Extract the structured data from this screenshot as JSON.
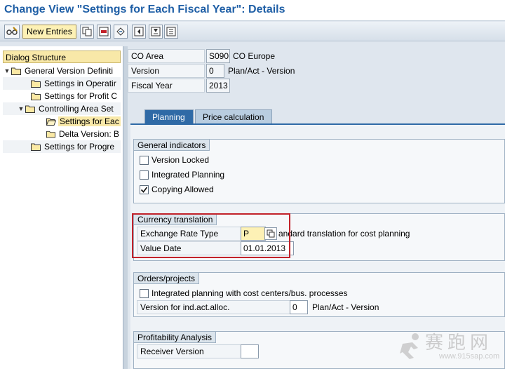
{
  "window": {
    "title": "Change View \"Settings for Each Fiscal Year\": Details"
  },
  "toolbar": {
    "new_entries_label": "New Entries",
    "icons": [
      "glasses-edit-icon",
      "copy-icon",
      "delete-icon",
      "undo-icon",
      "first-page-icon",
      "previous-page-icon",
      "next-page-icon"
    ]
  },
  "dialog_structure": {
    "header": "Dialog Structure",
    "items": [
      {
        "label": "General Version Definiti",
        "level": 0,
        "expanded": true
      },
      {
        "label": "Settings in Operatir",
        "level": 1
      },
      {
        "label": "Settings for Profit C",
        "level": 1
      },
      {
        "label": "Controlling Area Set",
        "level": 1,
        "expanded": true
      },
      {
        "label": "Settings for Eac",
        "level": 2,
        "selected": true
      },
      {
        "label": "Delta Version: B",
        "level": 2
      },
      {
        "label": "Settings for Progre",
        "level": 1
      }
    ]
  },
  "header_fields": {
    "co_area": {
      "label": "CO Area",
      "value": "S090",
      "desc": "CO Europe"
    },
    "version": {
      "label": "Version",
      "value": "0",
      "desc": "Plan/Act - Version"
    },
    "fiscal_year": {
      "label": "Fiscal Year",
      "value": "2013"
    }
  },
  "tabs": [
    {
      "label": "Planning",
      "active": true
    },
    {
      "label": "Price calculation",
      "active": false
    }
  ],
  "general_indicators": {
    "title": "General indicators",
    "version_locked": {
      "label": "Version Locked",
      "checked": false
    },
    "integrated_planning": {
      "label": "Integrated Planning",
      "checked": false
    },
    "copying_allowed": {
      "label": "Copying Allowed",
      "checked": true
    }
  },
  "currency_translation": {
    "title": "Currency translation",
    "exchange_rate_type": {
      "label": "Exchange Rate Type",
      "value": "P",
      "desc": "andard translation for cost planning"
    },
    "value_date": {
      "label": "Value Date",
      "value": "01.01.2013"
    }
  },
  "orders_projects": {
    "title": "Orders/projects",
    "integrated_planning": {
      "label": "Integrated planning with cost centers/bus. processes",
      "checked": false
    },
    "version_alloc": {
      "label": "Version for ind.act.alloc.",
      "value": "0",
      "desc": "Plan/Act - Version"
    }
  },
  "profitability_analysis": {
    "title": "Profitability Analysis",
    "receiver_version": {
      "label": "Receiver Version",
      "value": ""
    }
  },
  "watermark": {
    "text": "赛跑网",
    "url": "www.915sap.com"
  },
  "colors": {
    "title": "#1f5fa6",
    "tab_active": "#2f6aa6",
    "highlight": "#c2222a",
    "selection": "#f8e8a8"
  }
}
